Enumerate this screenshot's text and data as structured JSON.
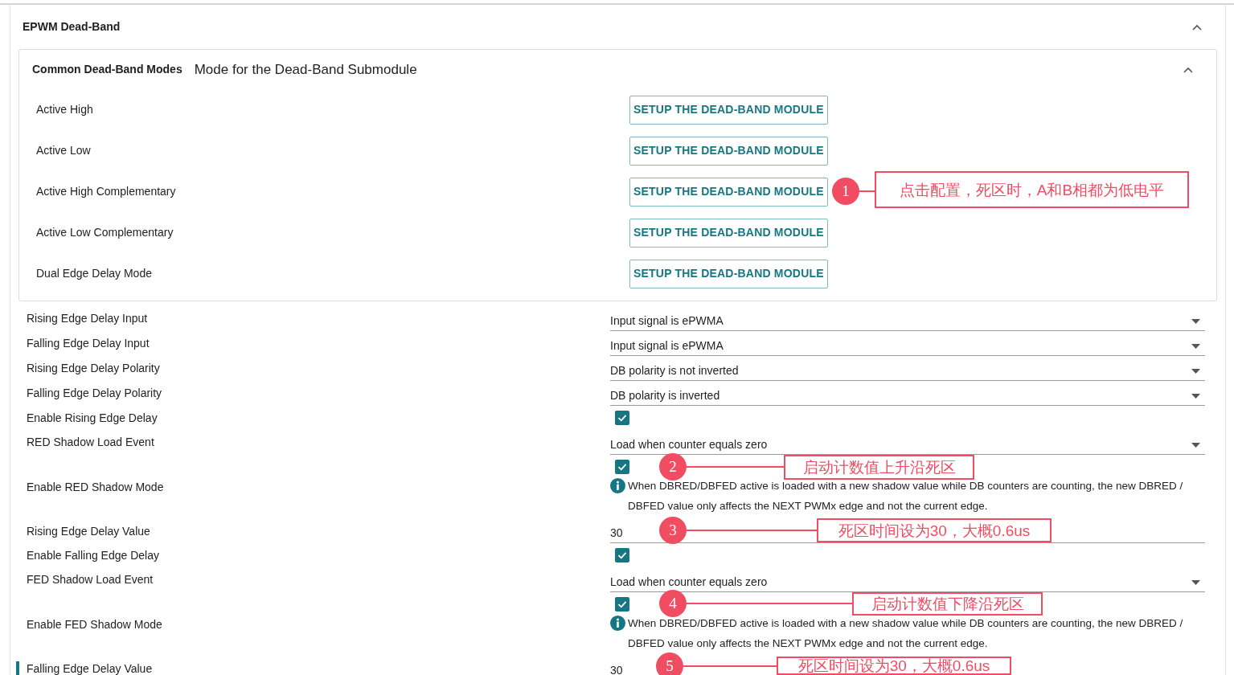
{
  "panel": {
    "title": "EPWM Dead-Band",
    "expanded": true,
    "modes": {
      "title": "Common Dead-Band Modes",
      "description": "Mode for the Dead-Band Submodule",
      "expanded": true,
      "items": [
        {
          "label": "Active High",
          "button": "SETUP THE DEAD-BAND MODULE"
        },
        {
          "label": "Active Low",
          "button": "SETUP THE DEAD-BAND MODULE"
        },
        {
          "label": "Active High Complementary",
          "button": "SETUP THE DEAD-BAND MODULE"
        },
        {
          "label": "Active Low Complementary",
          "button": "SETUP THE DEAD-BAND MODULE"
        },
        {
          "label": "Dual Edge Delay Mode",
          "button": "SETUP THE DEAD-BAND MODULE"
        }
      ]
    },
    "settings": [
      {
        "kind": "select",
        "label": "Rising Edge Delay Input",
        "value": "Input signal is ePWMA",
        "selected": false
      },
      {
        "kind": "select",
        "label": "Falling Edge Delay Input",
        "value": "Input signal is ePWMA",
        "selected": false
      },
      {
        "kind": "select",
        "label": "Rising Edge Delay Polarity",
        "value": "DB polarity is not inverted",
        "selected": false
      },
      {
        "kind": "select",
        "label": "Falling Edge Delay Polarity",
        "value": "DB polarity is inverted",
        "selected": false
      },
      {
        "kind": "checkbox",
        "label": "Enable Rising Edge Delay",
        "checked": true,
        "selected": false
      },
      {
        "kind": "select",
        "label": "RED Shadow Load Event",
        "value": "Load when counter equals zero",
        "selected": false
      },
      {
        "kind": "checkbox_info",
        "label": "Enable RED Shadow Mode",
        "checked": true,
        "info": "When DBRED/DBFED active is loaded with a new shadow value while DB counters are counting, the new DBRED / DBFED value only affects the NEXT PWMx edge and not the current edge.",
        "selected": false
      },
      {
        "kind": "text",
        "label": "Rising Edge Delay Value",
        "value": "30",
        "selected": false
      },
      {
        "kind": "checkbox",
        "label": "Enable Falling Edge Delay",
        "checked": true,
        "selected": false
      },
      {
        "kind": "select",
        "label": "FED Shadow Load Event",
        "value": "Load when counter equals zero",
        "selected": false
      },
      {
        "kind": "checkbox_info",
        "label": "Enable FED Shadow Mode",
        "checked": true,
        "info": "When DBRED/DBFED active is loaded with a new shadow value while DB counters are counting, the new DBRED / DBFED value only affects the NEXT PWMx edge and not the current edge.",
        "selected": false
      },
      {
        "kind": "text",
        "label": "Falling Edge Delay Value",
        "value": "30",
        "selected": true
      }
    ]
  },
  "annotations": [
    {
      "number": "1",
      "text": "点击配置，死区时，A和B相都为低电平"
    },
    {
      "number": "2",
      "text": "启动计数值上升沿死区"
    },
    {
      "number": "3",
      "text": "死区时间设为30，大概0.6us"
    },
    {
      "number": "4",
      "text": "启动计数值下降沿死区"
    },
    {
      "number": "5",
      "text": "死区时间设为30，大概0.6us"
    }
  ]
}
